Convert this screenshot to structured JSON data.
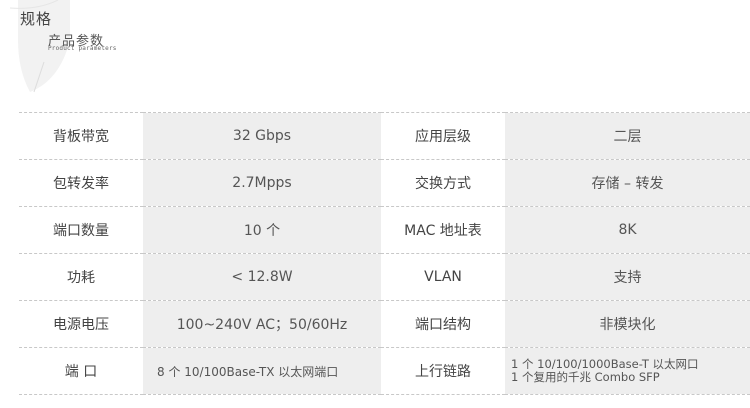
{
  "header": {
    "title": "规格",
    "subtitle": "产品参数",
    "subtitle_en": "Product parameters"
  },
  "specs": [
    {
      "label1": "背板带宽",
      "value1": "32 Gbps",
      "label2": "应用层级",
      "value2": "二层"
    },
    {
      "label1": "包转发率",
      "value1": "2.7Mpps",
      "label2": "交换方式",
      "value2": "存储 – 转发"
    },
    {
      "label1": "端口数量",
      "value1": "10 个",
      "label2": "MAC 地址表",
      "value2": "8K"
    },
    {
      "label1": "功耗",
      "value1": "< 12.8W",
      "label2": "VLAN",
      "value2": "支持"
    },
    {
      "label1": "电源电压",
      "value1": "100~240V AC；50/60Hz",
      "label2": "端口结构",
      "value2": "非模块化"
    },
    {
      "label1": "端 口",
      "value1": "8 个 10/100Base-TX 以太网端口",
      "label2": "上行链路",
      "value2_line1": "1 个 10/100/1000Base-T 以太网口",
      "value2_line2": "1 个复用的千兆 Combo SFP"
    }
  ]
}
